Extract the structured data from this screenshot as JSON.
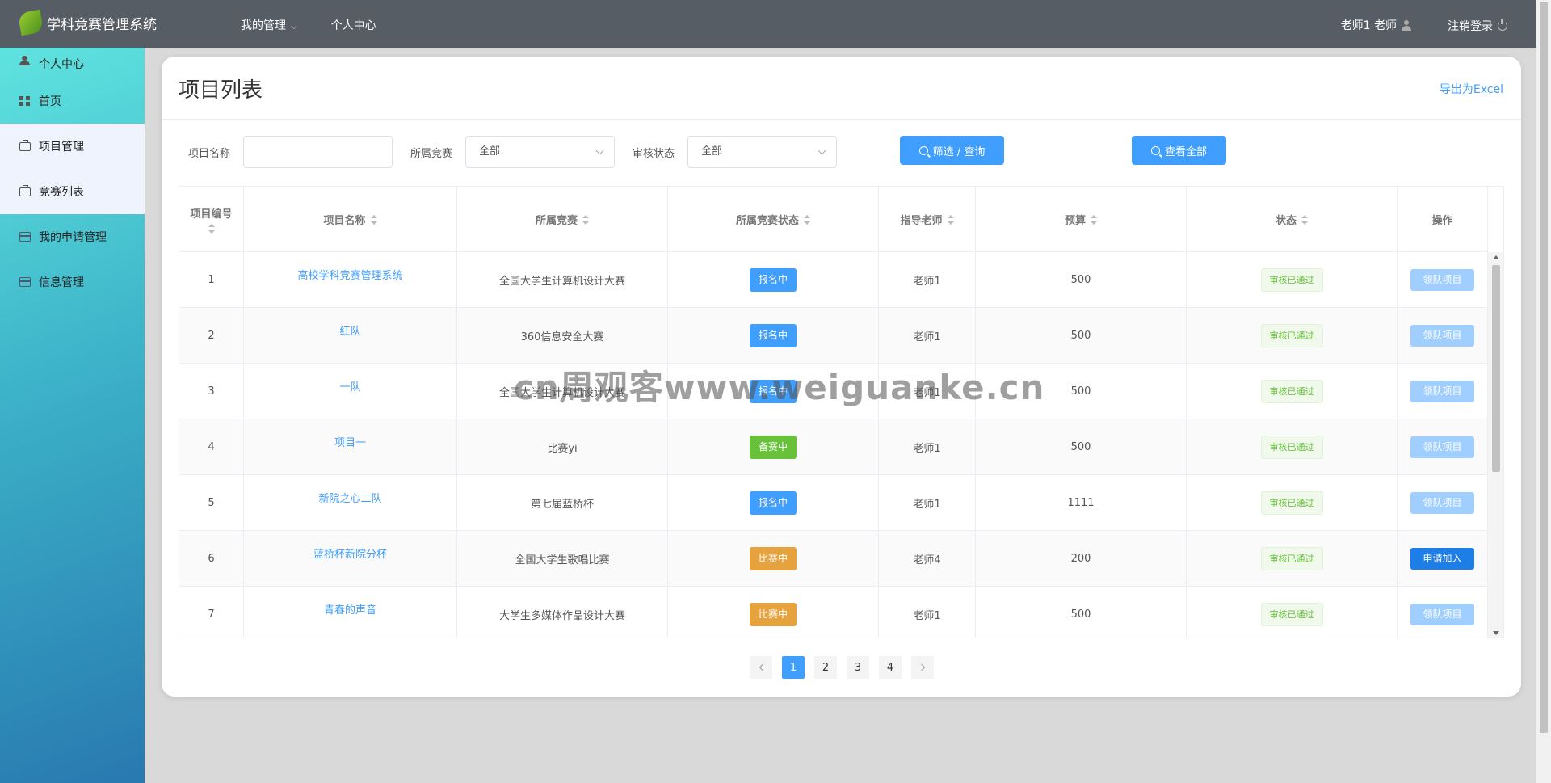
{
  "app": {
    "title": "学科竞赛管理系统"
  },
  "topnav": {
    "items": [
      {
        "label": "我的管理",
        "has_caret": true
      },
      {
        "label": "个人中心"
      }
    ]
  },
  "user": {
    "name": "老师1 老师",
    "logout": "注销登录"
  },
  "sidebar": {
    "items": [
      {
        "label": "个人中心",
        "icon": "person-icon"
      },
      {
        "label": "首页",
        "icon": "grid-icon"
      },
      {
        "label": "项目管理",
        "icon": "briefcase-icon",
        "active": true
      },
      {
        "label": "竞赛列表",
        "icon": "briefcase-icon",
        "active": true
      },
      {
        "label": "我的申请管理",
        "icon": "card-icon"
      },
      {
        "label": "信息管理",
        "icon": "card-icon"
      }
    ]
  },
  "page": {
    "title": "项目列表",
    "export": "导出为Excel"
  },
  "filters": {
    "name_label": "项目名称",
    "name_value": "",
    "competition_label": "所属竞赛",
    "competition_value": "全部",
    "audit_label": "审核状态",
    "audit_value": "全部",
    "search_btn": "筛选 / 查询",
    "all_btn": "查看全部"
  },
  "table": {
    "headers": [
      "项目编号",
      "项目名称",
      "所属竞赛",
      "所属竞赛状态",
      "指导老师",
      "预算",
      "状态",
      "操作"
    ],
    "rows": [
      {
        "id": "1",
        "name": "高校学科竞赛管理系统",
        "competition": "全国大学生计算机设计大赛",
        "comp_status": "报名中",
        "comp_color": "blue",
        "teacher": "老师1",
        "budget": "500",
        "status": "审核已通过",
        "op": "领队项目",
        "op_type": "disabled"
      },
      {
        "id": "2",
        "name": "红队",
        "competition": "360信息安全大赛",
        "comp_status": "报名中",
        "comp_color": "blue",
        "teacher": "老师1",
        "budget": "500",
        "status": "审核已通过",
        "op": "领队项目",
        "op_type": "disabled"
      },
      {
        "id": "3",
        "name": "一队",
        "competition": "全国大学生计算机设计大赛",
        "comp_status": "报名中",
        "comp_color": "blue",
        "teacher": "老师1",
        "budget": "500",
        "status": "审核已通过",
        "op": "领队项目",
        "op_type": "disabled"
      },
      {
        "id": "4",
        "name": "项目一",
        "competition": "比赛yi",
        "comp_status": "备赛中",
        "comp_color": "green",
        "teacher": "老师1",
        "budget": "500",
        "status": "审核已通过",
        "op": "领队项目",
        "op_type": "disabled"
      },
      {
        "id": "5",
        "name": "新院之心二队",
        "competition": "第七届蓝桥杯",
        "comp_status": "报名中",
        "comp_color": "blue",
        "teacher": "老师1",
        "budget": "1111",
        "status": "审核已通过",
        "op": "领队项目",
        "op_type": "disabled"
      },
      {
        "id": "6",
        "name": "蓝桥杯新院分杯",
        "competition": "全国大学生歌唱比赛",
        "comp_status": "比赛中",
        "comp_color": "orange",
        "teacher": "老师4",
        "budget": "200",
        "status": "审核已通过",
        "op": "申请加入",
        "op_type": "primary"
      },
      {
        "id": "7",
        "name": "青春的声音",
        "competition": "大学生多媒体作品设计大赛",
        "comp_status": "比赛中",
        "comp_color": "orange",
        "teacher": "老师1",
        "budget": "500",
        "status": "审核已通过",
        "op": "领队项目",
        "op_type": "disabled"
      }
    ]
  },
  "pagination": {
    "pages": [
      "1",
      "2",
      "3",
      "4"
    ],
    "current": "1"
  },
  "watermark": "cn周观客www.weiguanke.cn"
}
